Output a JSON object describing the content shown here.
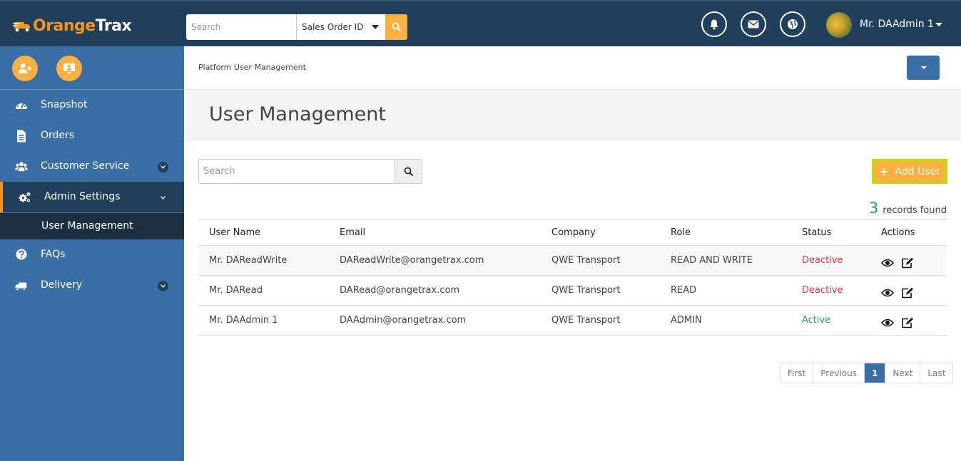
{
  "brand": {
    "name_orange": "Orange",
    "name_white": "Trax"
  },
  "header": {
    "search_placeholder": "Search",
    "search_type": "Sales Order ID",
    "user_name": "Mr. DAAdmin 1"
  },
  "sidebar": {
    "items": [
      {
        "label": "Snapshot",
        "icon": "dashboard-icon"
      },
      {
        "label": "Orders",
        "icon": "document-icon"
      },
      {
        "label": "Customer Service",
        "icon": "users-icon"
      },
      {
        "label": "Admin Settings",
        "icon": "gears-icon"
      },
      {
        "label": "FAQs",
        "icon": "question-icon"
      },
      {
        "label": "Delivery",
        "icon": "truck-icon"
      }
    ],
    "subitem": "User Management"
  },
  "breadcrumb": "Platform User Management",
  "page_title": "User Management",
  "table_search_placeholder": "Search",
  "add_user_label": "Add User",
  "records": {
    "count": "3",
    "label": "records found"
  },
  "table": {
    "headers": [
      "User Name",
      "Email",
      "Company",
      "Role",
      "Status",
      "Actions"
    ],
    "rows": [
      {
        "name": "Mr. DAReadWrite",
        "email": "DAReadWrite@orangetrax.com",
        "company": "QWE Transport",
        "role": "READ AND WRITE",
        "status": "Deactive"
      },
      {
        "name": "Mr. DARead",
        "email": "DARead@orangetrax.com",
        "company": "QWE Transport",
        "role": "READ",
        "status": "Deactive"
      },
      {
        "name": "Mr. DAAdmin 1",
        "email": "DAAdmin@orangetrax.com",
        "company": "QWE Transport",
        "role": "ADMIN",
        "status": "Active"
      }
    ]
  },
  "pagination": {
    "first": "First",
    "previous": "Previous",
    "current": "1",
    "next": "Next",
    "last": "Last"
  },
  "colors": {
    "topbar": "#1f3f5c",
    "sidebar": "#3a6fa5",
    "accent": "#fbb040",
    "active_status": "#2ea44f",
    "deactive_status": "#d23c3c"
  }
}
